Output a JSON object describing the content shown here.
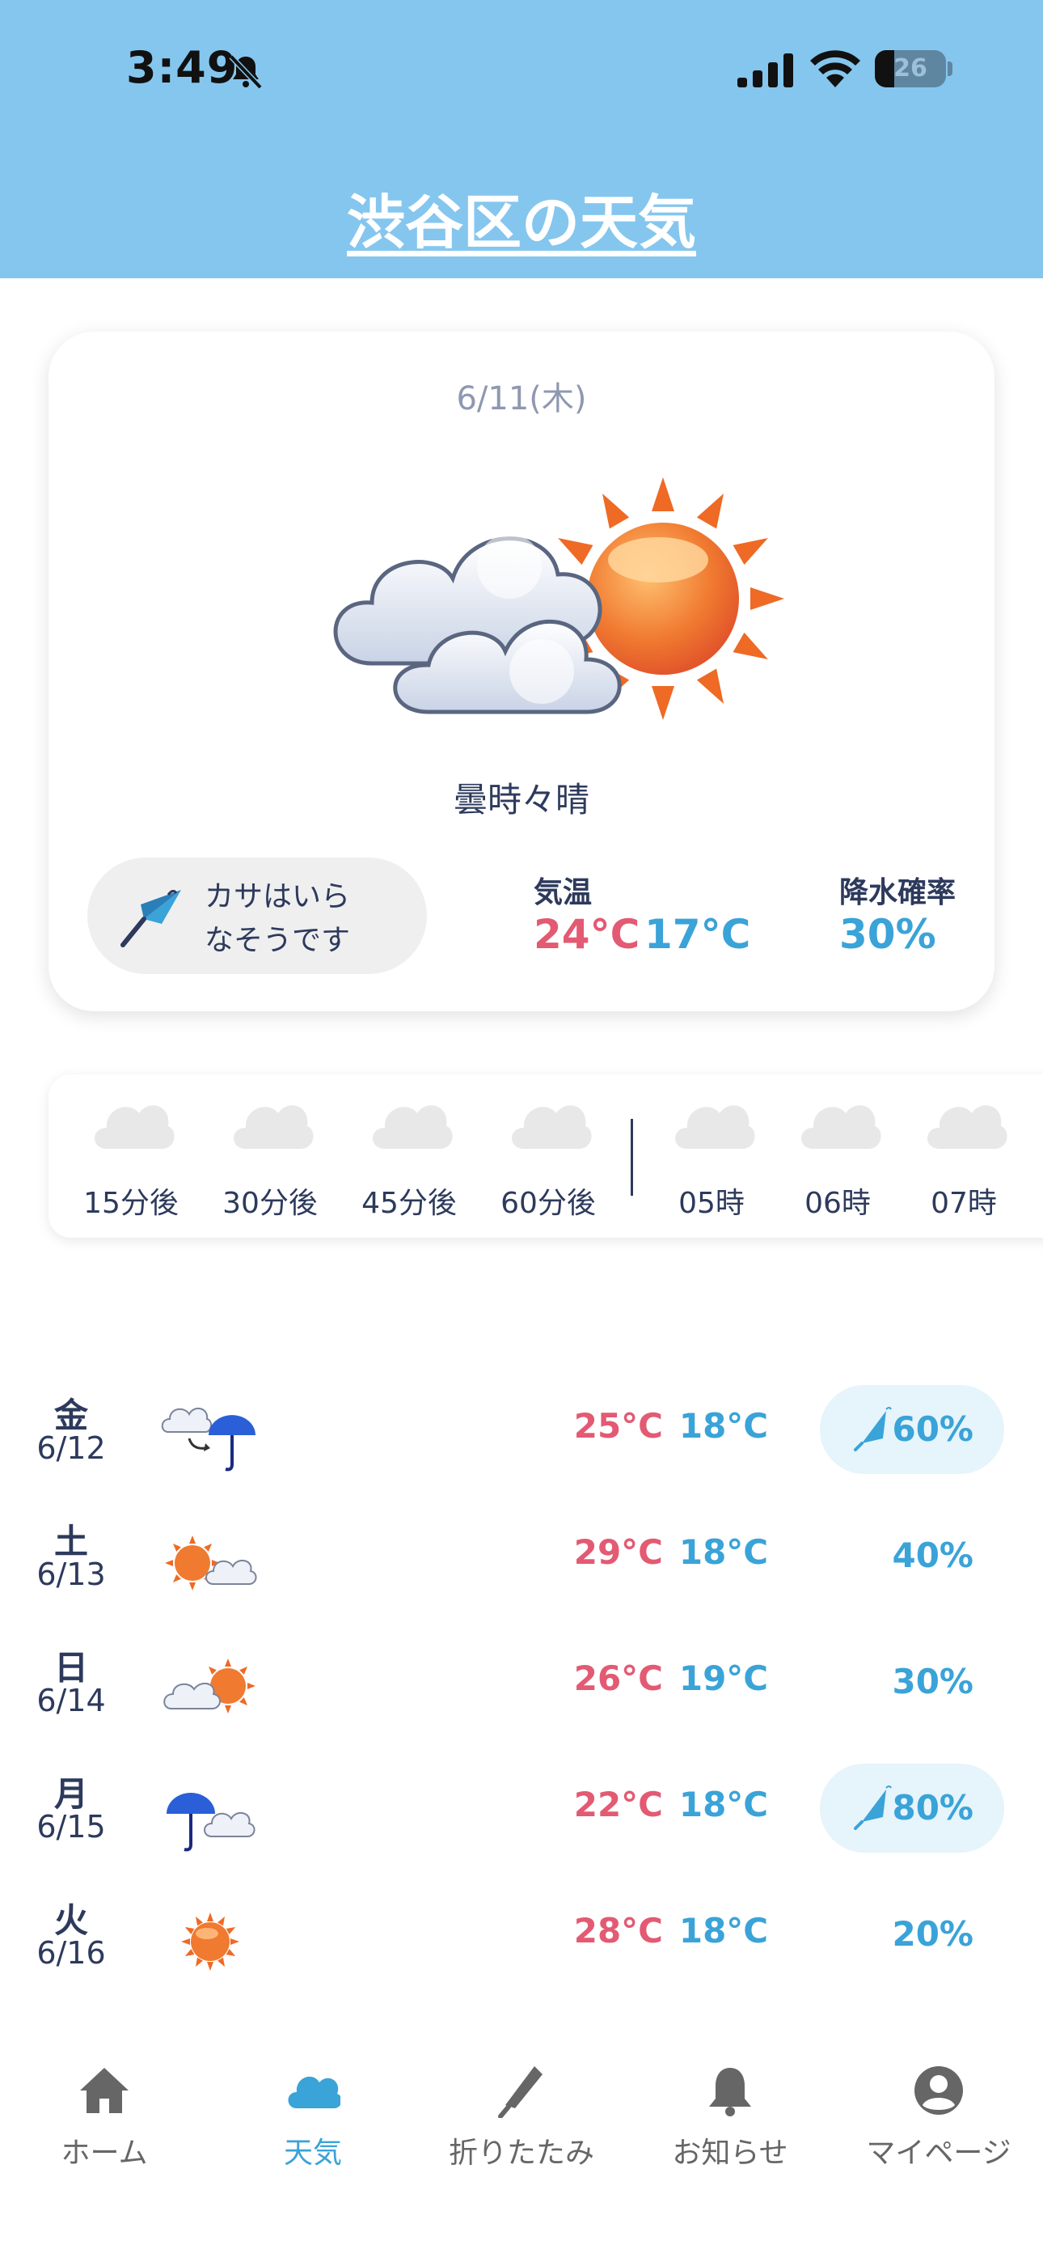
{
  "status": {
    "time": "3:49",
    "battery": "26"
  },
  "title": "渋谷区の天気",
  "today": {
    "date": "6/11(木)",
    "condition": "曇時々晴",
    "umbrella_message_line1": "カサはいら",
    "umbrella_message_line2": "なそうです",
    "temp_label": "気温",
    "temp_high": "24°C",
    "temp_low": "17°C",
    "rain_label": "降水確率",
    "rain_value": "30%",
    "weather_icon": "cloudy-sun-icon"
  },
  "forecast_strip": [
    {
      "label": "15分後",
      "icon": "cloud-icon"
    },
    {
      "label": "30分後",
      "icon": "cloud-icon"
    },
    {
      "label": "45分後",
      "icon": "cloud-icon"
    },
    {
      "label": "60分後",
      "icon": "cloud-icon"
    },
    {
      "label": "05時",
      "icon": "cloud-icon"
    },
    {
      "label": "06時",
      "icon": "cloud-icon"
    },
    {
      "label": "07時",
      "icon": "cloud-icon"
    }
  ],
  "daily": [
    {
      "day": "金",
      "date": "6/12",
      "icon": "cloud-then-rain-icon",
      "high": "25°C",
      "low": "18°C",
      "rain": "60%",
      "umbrella": true
    },
    {
      "day": "土",
      "date": "6/13",
      "icon": "sun-cloud-icon",
      "high": "29°C",
      "low": "18°C",
      "rain": "40%",
      "umbrella": false
    },
    {
      "day": "日",
      "date": "6/14",
      "icon": "cloud-sun-icon",
      "high": "26°C",
      "low": "19°C",
      "rain": "30%",
      "umbrella": false
    },
    {
      "day": "月",
      "date": "6/15",
      "icon": "rain-cloud-icon",
      "high": "22°C",
      "low": "18°C",
      "rain": "80%",
      "umbrella": true
    },
    {
      "day": "火",
      "date": "6/16",
      "icon": "sun-icon",
      "high": "28°C",
      "low": "18°C",
      "rain": "20%",
      "umbrella": false
    }
  ],
  "tabs": [
    {
      "label": "ホーム",
      "icon": "home-icon"
    },
    {
      "label": "天気",
      "icon": "cloud-icon",
      "active": true
    },
    {
      "label": "折りたたみ",
      "icon": "folded-umbrella-icon"
    },
    {
      "label": "お知らせ",
      "icon": "bell-icon"
    },
    {
      "label": "マイページ",
      "icon": "user-circle-icon"
    }
  ],
  "colors": {
    "header": "#85c6ee",
    "high_temp": "#e35a73",
    "low_temp": "#3aa3d8",
    "text": "#2d3a5c",
    "tab_active": "#3aa3d8",
    "rain_highlight": "#e6f4fb"
  }
}
